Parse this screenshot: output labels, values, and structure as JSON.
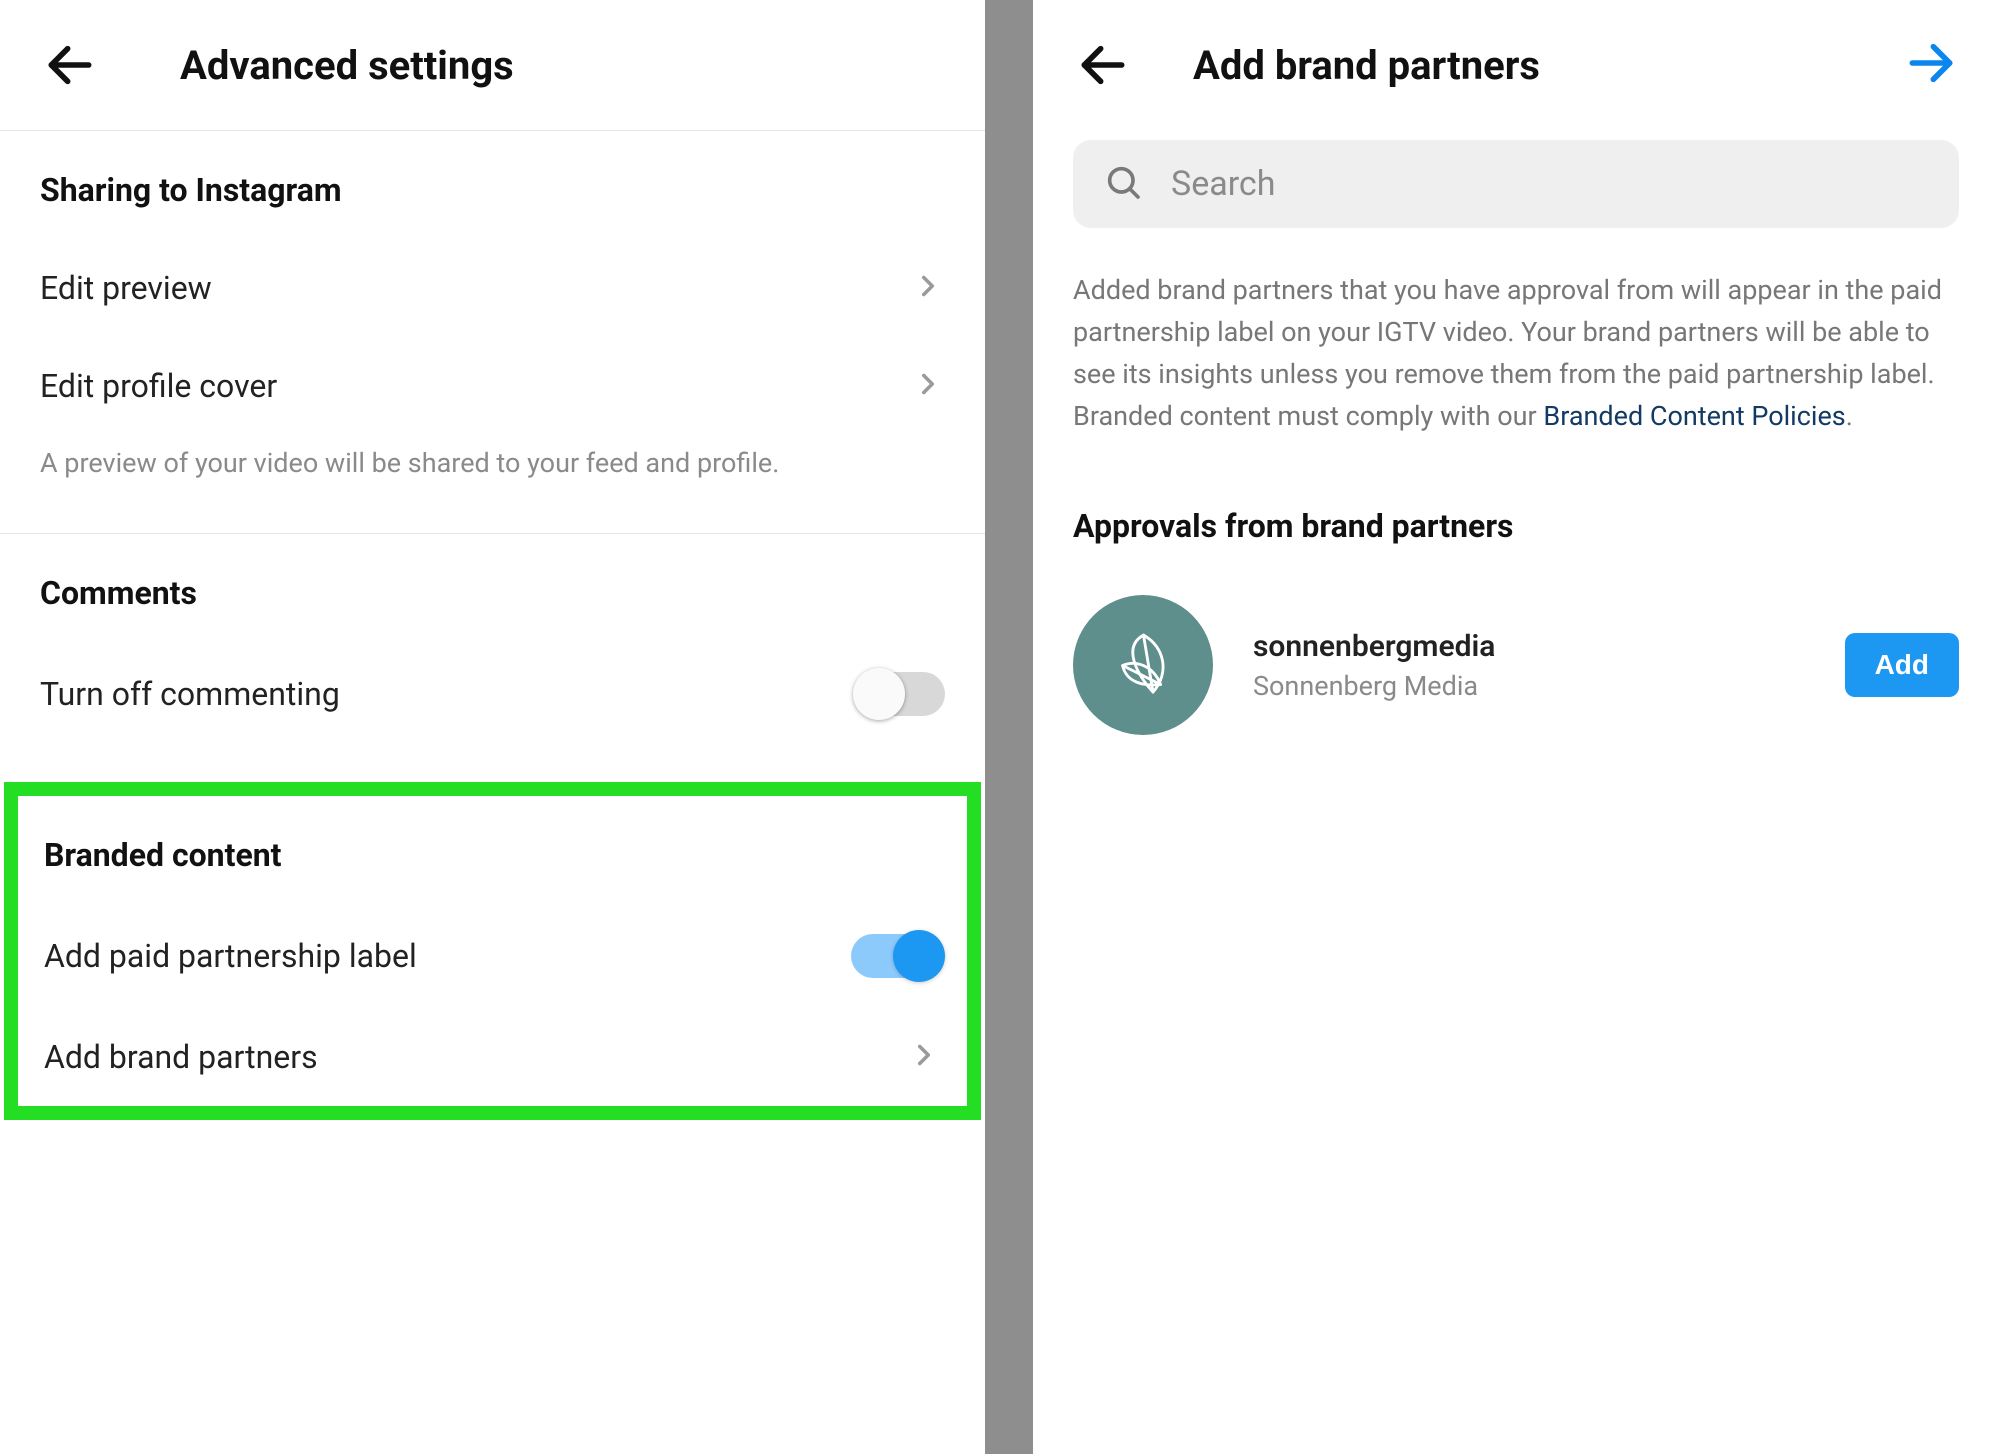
{
  "left": {
    "header_title": "Advanced settings",
    "section_sharing": "Sharing to Instagram",
    "row_edit_preview": "Edit preview",
    "row_edit_cover": "Edit profile cover",
    "desc_preview": "A preview of your video will be shared to your feed and profile.",
    "section_comments": "Comments",
    "row_turn_off_commenting": "Turn off commenting",
    "section_branded": "Branded content",
    "row_paid_label": "Add paid partnership label",
    "row_add_partners": "Add brand partners"
  },
  "right": {
    "header_title": "Add brand partners",
    "search_placeholder": "Search",
    "info_text_1": "Added brand partners that you have approval from will appear in the paid partnership label on your IGTV video. Your brand partners will be able to see its insights unless you remove them from the paid partnership label. Branded content must comply with our ",
    "info_link": "Branded Content Policies",
    "info_dot": ".",
    "approvals_title": "Approvals from brand partners",
    "partner": {
      "username": "sonnenbergmedia",
      "display": "Sonnenberg Media",
      "button": "Add"
    }
  }
}
